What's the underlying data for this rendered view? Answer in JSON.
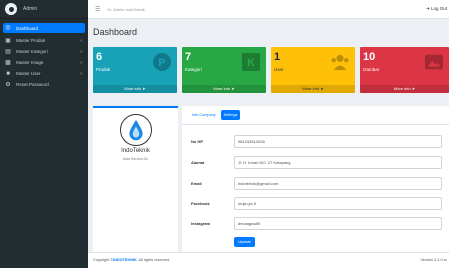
{
  "sidebar": {
    "brand": "Admin",
    "items": [
      {
        "label": "Dashboard",
        "icon": "dashboard-icon"
      },
      {
        "label": "Master Produk",
        "icon": "box-icon"
      },
      {
        "label": "Master Kategori",
        "icon": "list-icon"
      },
      {
        "label": "Master Image",
        "icon": "image-icon"
      },
      {
        "label": "Master User",
        "icon": "user-icon"
      },
      {
        "label": "Reset Password",
        "icon": "gear-icon"
      }
    ]
  },
  "topbar": {
    "greeting": "Hi, Admin IndoTeknik",
    "logout": "Log Out"
  },
  "page_title": "Dashboard",
  "stats": [
    {
      "value": "6",
      "label": "Produk",
      "more": "More info",
      "color": "#17a2b8",
      "icon": "p-icon"
    },
    {
      "value": "7",
      "label": "Kategori",
      "more": "More info",
      "color": "#28a745",
      "icon": "k-icon"
    },
    {
      "value": "1",
      "label": "User",
      "more": "More info",
      "color": "#ffc107",
      "icon": "users-icon"
    },
    {
      "value": "10",
      "label": "Gambar",
      "more": "More info",
      "color": "#dc3545",
      "icon": "image-icon"
    }
  ],
  "profile": {
    "name": "IndoTeknik",
    "tagline": "Jasa Service AC"
  },
  "tabs": {
    "info": "Info Company",
    "settings": "Settings"
  },
  "form": {
    "fields": [
      {
        "label": "No HP",
        "value": "081333513208"
      },
      {
        "label": "Alamat",
        "value": "Jl. H. Imran NO. 27 Ketapang"
      },
      {
        "label": "Email",
        "value": "indoteknik@gmail.com"
      },
      {
        "label": "Facebook",
        "value": "mujio.jio.9"
      },
      {
        "label": "Instagram",
        "value": "devaagna89"
      }
    ],
    "update": "Update"
  },
  "footer": {
    "prefix": "Copyright ©",
    "brand": "INDOTEKNIK",
    "suffix": ". All rights reserved.",
    "version": "Version 3.1.0-rc"
  }
}
